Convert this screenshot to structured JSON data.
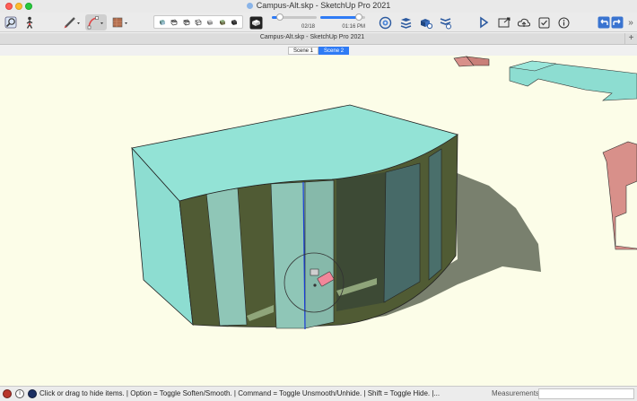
{
  "window": {
    "title": "Campus-Alt.skp - SketchUp Pro 2021",
    "document_tab": "Campus-Alt.skp - SketchUp Pro 2021",
    "add_tab_label": "+"
  },
  "toolbar": {
    "tools": [
      {
        "name": "search-icon"
      },
      {
        "name": "person-icon"
      },
      {
        "name": "pencil-icon"
      },
      {
        "name": "eraser-icon"
      },
      {
        "name": "paint-bucket-icon"
      },
      {
        "name": "styles-icon"
      },
      {
        "name": "geo-location-icon"
      },
      {
        "name": "layers-icon"
      },
      {
        "name": "components-icon"
      },
      {
        "name": "adjustments-icon"
      },
      {
        "name": "play-icon"
      },
      {
        "name": "export-icon"
      },
      {
        "name": "cloud-icon"
      },
      {
        "name": "checkbox-icon"
      },
      {
        "name": "info-icon"
      },
      {
        "name": "undo-icon"
      },
      {
        "name": "redo-icon"
      }
    ],
    "shadow_date": "02/18",
    "shadow_time": "01:16 PM",
    "shadow_date_fraction": 0.17,
    "shadow_time_fraction": 0.85,
    "overflow_label": "»"
  },
  "scenes": {
    "tabs": [
      "Scene 1",
      "Scene 2"
    ],
    "active_index": 1
  },
  "status": {
    "message": "Click or drag to hide items. | Option = Toggle Soften/Smooth. | Command = Toggle Unsmooth/Unhide. | Shift = Toggle Hide. |...",
    "measurements_label": "Measurements",
    "measurements_value": ""
  },
  "colors": {
    "viewport_bg": "#fcfde8",
    "building_face": "#8dddd1",
    "building_top": "#93e3d6",
    "shadow": "#79806e",
    "neighbor_building": "#d8908a",
    "blue_axis": "#1a3cd6",
    "accent": "#2f7bf5"
  }
}
